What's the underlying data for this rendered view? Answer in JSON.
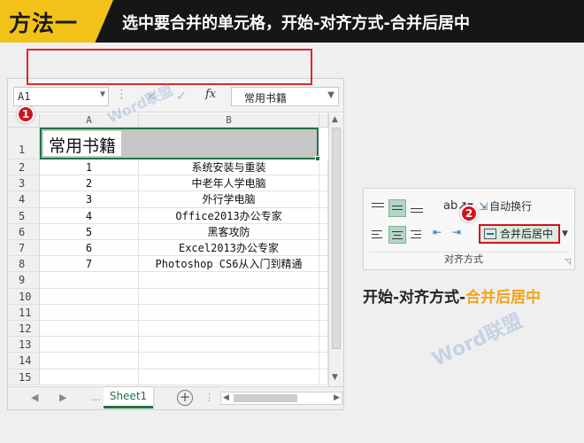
{
  "banner": {
    "tag": "方法一",
    "title": "选中要合并的单元格，开始-对齐方式-合并后居中"
  },
  "excel": {
    "name_box": "A1",
    "formula_bar": {
      "cancel_icon": "×",
      "enter_icon": "✓",
      "fx_label": "fx",
      "value": "常用书籍"
    },
    "columns": [
      "A",
      "B"
    ],
    "merged_cell": "常用书籍",
    "rows": [
      {
        "num": "1",
        "a": "",
        "b": ""
      },
      {
        "num": "2",
        "a": "1",
        "b": "系统安装与重装"
      },
      {
        "num": "3",
        "a": "2",
        "b": "中老年人学电脑"
      },
      {
        "num": "4",
        "a": "3",
        "b": "外行学电脑"
      },
      {
        "num": "5",
        "a": "4",
        "b": "Office2013办公专家"
      },
      {
        "num": "6",
        "a": "5",
        "b": "黑客攻防"
      },
      {
        "num": "7",
        "a": "6",
        "b": "Excel2013办公专家"
      },
      {
        "num": "8",
        "a": "7",
        "b": "Photoshop CS6从入门到精通"
      },
      {
        "num": "9",
        "a": "",
        "b": ""
      },
      {
        "num": "10",
        "a": "",
        "b": ""
      },
      {
        "num": "11",
        "a": "",
        "b": ""
      },
      {
        "num": "12",
        "a": "",
        "b": ""
      },
      {
        "num": "13",
        "a": "",
        "b": ""
      },
      {
        "num": "14",
        "a": "",
        "b": ""
      },
      {
        "num": "15",
        "a": "",
        "b": ""
      }
    ],
    "sheet_tab": "Sheet1",
    "add_sheet": "+"
  },
  "markers": {
    "one": "1",
    "two": "2"
  },
  "ribbon": {
    "wrap_text": "自动换行",
    "merge_center": "合并后居中",
    "group_label": "对齐方式"
  },
  "caption": {
    "part1": "开始-对齐方式-",
    "part2": "合并后居中"
  },
  "watermark": "Word联盟",
  "colors": {
    "banner_bg": "#161616",
    "banner_tag": "#f3c218",
    "excel_green": "#217346",
    "highlight_red": "#e0272d",
    "caption_accent": "#f3a417"
  }
}
